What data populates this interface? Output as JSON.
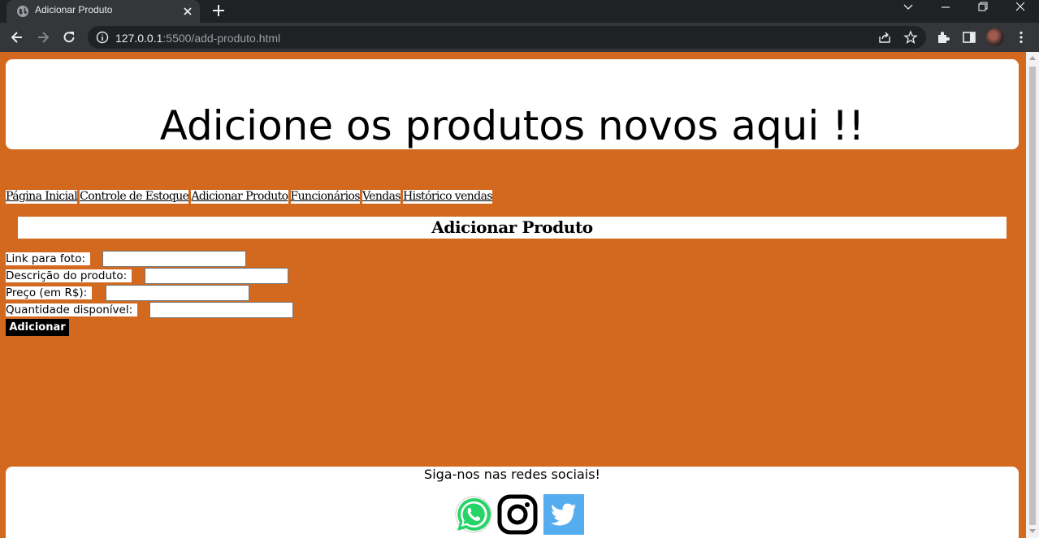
{
  "browser": {
    "tab_title": "Adicionar Produto",
    "url_host": "127.0.0.1",
    "url_rest": ":5500/add-produto.html"
  },
  "page": {
    "header_title": "Adicione os produtos novos aqui !!",
    "nav": [
      {
        "label": "Página Inicial"
      },
      {
        "label": "Controle de Estoque"
      },
      {
        "label": "Adicionar Produto"
      },
      {
        "label": "Funcionários"
      },
      {
        "label": "Vendas"
      },
      {
        "label": "Histórico vendas"
      }
    ],
    "section_title": "Adicionar Produto",
    "form": {
      "fields": [
        {
          "label": "Link para foto:",
          "value": ""
        },
        {
          "label": "Descrição do produto:",
          "value": ""
        },
        {
          "label": "Preço (em R$):",
          "value": ""
        },
        {
          "label": "Quantidade disponível:",
          "value": ""
        }
      ],
      "submit_label": "Adicionar"
    },
    "footer_text": "Siga-nos nas redes sociais!",
    "social_icons": [
      "whatsapp-icon",
      "instagram-icon",
      "twitter-icon"
    ]
  },
  "colors": {
    "page_background": "#d2691e",
    "panel": "#ffffff",
    "button": "#000000"
  }
}
